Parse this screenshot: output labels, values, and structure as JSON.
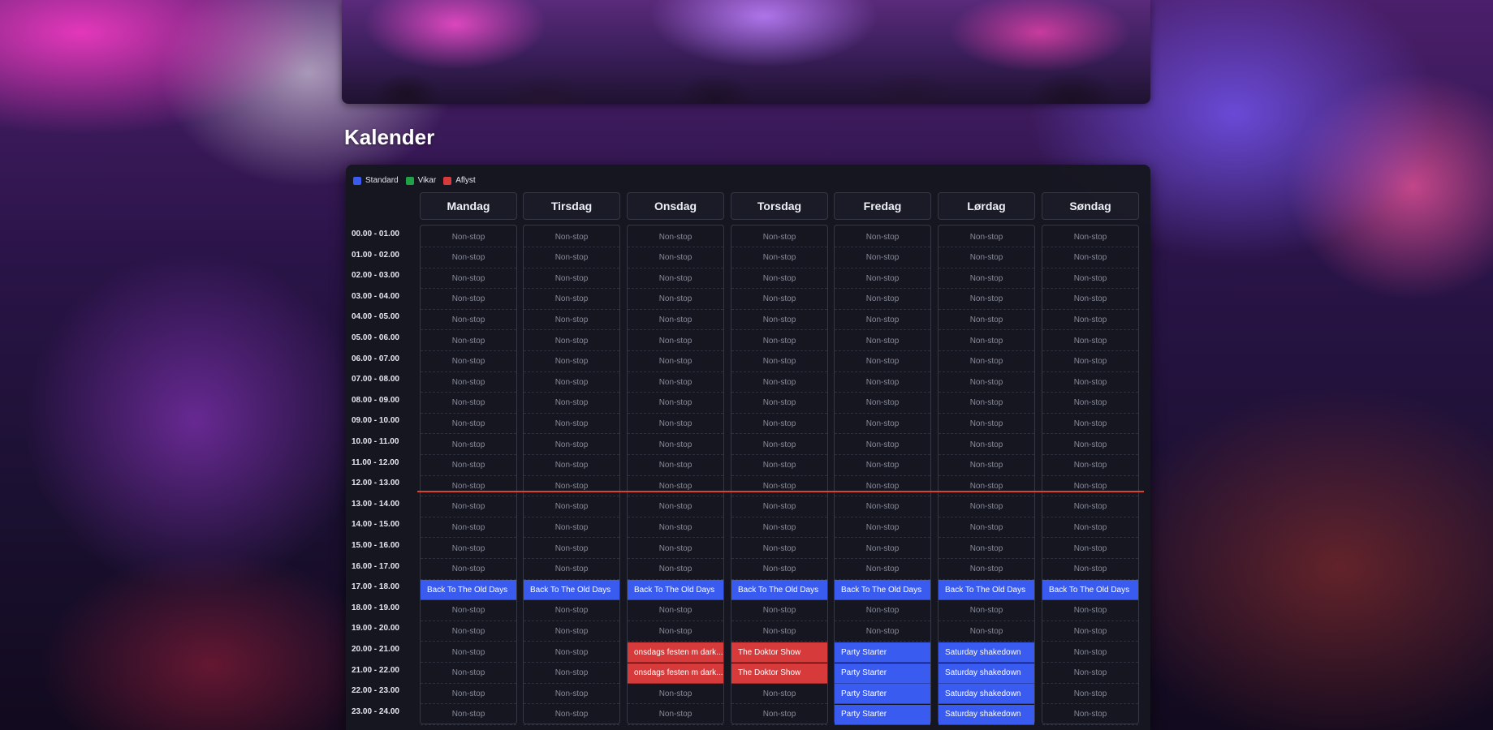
{
  "page": {
    "title": "Kalender"
  },
  "legend": [
    {
      "label": "Standard",
      "color": "#3a5bf0"
    },
    {
      "label": "Vikar",
      "color": "#22a045"
    },
    {
      "label": "Aflyst",
      "color": "#d63a3a"
    }
  ],
  "status_colors": {
    "standard": "#3a5bf0",
    "vikar": "#22a045",
    "aflyst": "#d63a3a"
  },
  "days": [
    "Mandag",
    "Tirsdag",
    "Onsdag",
    "Torsdag",
    "Fredag",
    "Lørdag",
    "Søndag"
  ],
  "times": [
    "00.00 - 01.00",
    "01.00 - 02.00",
    "02.00 - 03.00",
    "03.00 - 04.00",
    "04.00 - 05.00",
    "05.00 - 06.00",
    "06.00 - 07.00",
    "07.00 - 08.00",
    "08.00 - 09.00",
    "09.00 - 10.00",
    "10.00 - 11.00",
    "11.00 - 12.00",
    "12.00 - 13.00",
    "13.00 - 14.00",
    "14.00 - 15.00",
    "15.00 - 16.00",
    "16.00 - 17.00",
    "17.00 - 18.00",
    "18.00 - 19.00",
    "19.00 - 20.00",
    "20.00 - 21.00",
    "21.00 - 22.00",
    "22.00 - 23.00",
    "23.00 - 24.00"
  ],
  "default_slot_label": "Non-stop",
  "current_time_slot": 12,
  "events": [
    {
      "day": 0,
      "slot": 17,
      "title": "Back To The Old Days",
      "status": "standard"
    },
    {
      "day": 1,
      "slot": 17,
      "title": "Back To The Old Days",
      "status": "standard"
    },
    {
      "day": 2,
      "slot": 17,
      "title": "Back To The Old Days",
      "status": "standard"
    },
    {
      "day": 3,
      "slot": 17,
      "title": "Back To The Old Days",
      "status": "standard"
    },
    {
      "day": 4,
      "slot": 17,
      "title": "Back To The Old Days",
      "status": "standard"
    },
    {
      "day": 5,
      "slot": 17,
      "title": "Back To The Old Days",
      "status": "standard"
    },
    {
      "day": 6,
      "slot": 17,
      "title": "Back To The Old Days",
      "status": "standard"
    },
    {
      "day": 2,
      "slot": 20,
      "title": "onsdags festen m dark...",
      "status": "aflyst"
    },
    {
      "day": 2,
      "slot": 21,
      "title": "onsdags festen m dark...",
      "status": "aflyst"
    },
    {
      "day": 3,
      "slot": 20,
      "title": "The Doktor Show",
      "status": "aflyst"
    },
    {
      "day": 3,
      "slot": 21,
      "title": "The Doktor Show",
      "status": "aflyst"
    },
    {
      "day": 4,
      "slot": 20,
      "title": "Party Starter",
      "status": "standard"
    },
    {
      "day": 4,
      "slot": 21,
      "title": "Party Starter",
      "status": "standard"
    },
    {
      "day": 4,
      "slot": 22,
      "title": "Party Starter",
      "status": "standard"
    },
    {
      "day": 4,
      "slot": 23,
      "title": "Party Starter",
      "status": "standard"
    },
    {
      "day": 5,
      "slot": 20,
      "title": "Saturday shakedown",
      "status": "standard"
    },
    {
      "day": 5,
      "slot": 21,
      "title": "Saturday shakedown",
      "status": "standard"
    },
    {
      "day": 5,
      "slot": 22,
      "title": "Saturday shakedown",
      "status": "standard"
    },
    {
      "day": 5,
      "slot": 23,
      "title": "Saturday shakedown",
      "status": "standard"
    }
  ]
}
